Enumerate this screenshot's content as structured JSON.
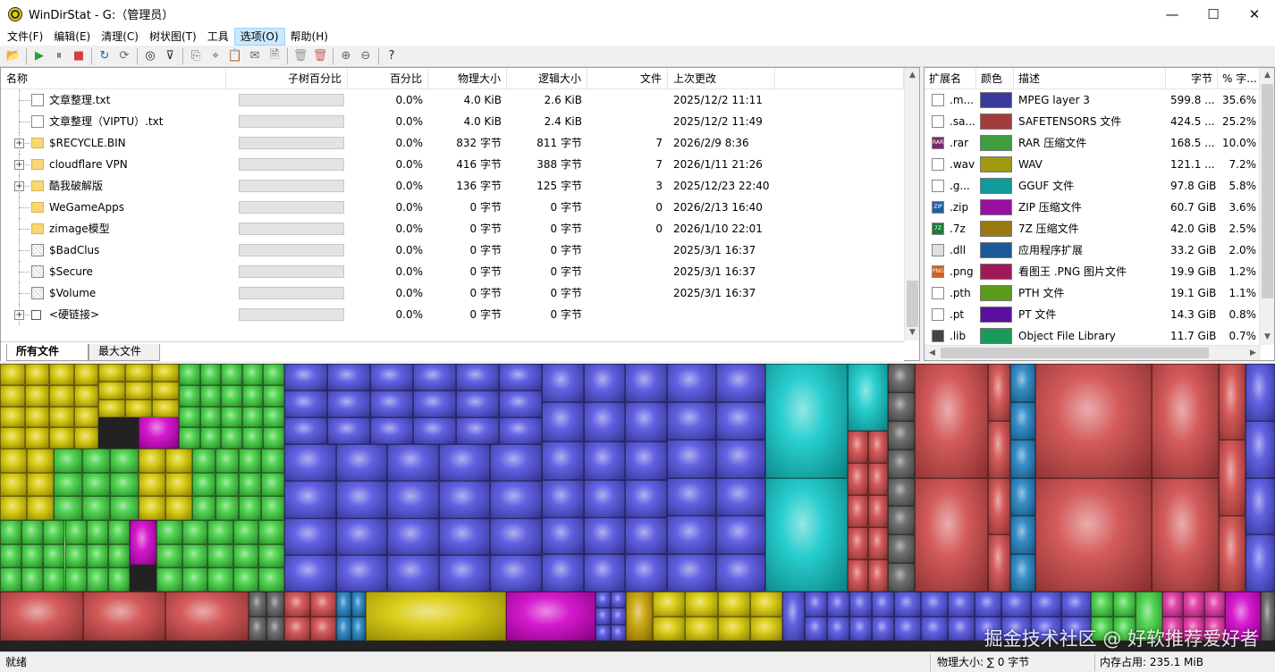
{
  "window": {
    "title": "WinDirStat - G:（管理员）",
    "minimize": "—",
    "maximize": "☐",
    "close": "✕"
  },
  "menu": [
    "文件(F)",
    "编辑(E)",
    "清理(C)",
    "树状图(T)",
    "工具",
    "选项(O)",
    "帮助(H)"
  ],
  "menu_active_index": 5,
  "toolbar": [
    {
      "name": "open-icon",
      "glyph": "📂"
    },
    {
      "sep": true
    },
    {
      "name": "play-icon",
      "glyph": "▶"
    },
    {
      "name": "pause-icon",
      "glyph": "⏸"
    },
    {
      "name": "stop-icon",
      "glyph": "■"
    },
    {
      "sep": true
    },
    {
      "name": "refresh-icon",
      "glyph": "↻"
    },
    {
      "name": "refresh-selected-icon",
      "glyph": "⟳"
    },
    {
      "sep": true
    },
    {
      "name": "zoom-scan-icon",
      "glyph": "◎"
    },
    {
      "name": "filter-icon",
      "glyph": "⊽"
    },
    {
      "sep": true
    },
    {
      "name": "copy-path-icon",
      "glyph": "⎘"
    },
    {
      "name": "explorer-icon",
      "glyph": "⌖"
    },
    {
      "name": "paste-icon",
      "glyph": "📋"
    },
    {
      "name": "properties-icon",
      "glyph": "✉"
    },
    {
      "name": "report-icon",
      "glyph": "🗎"
    },
    {
      "sep": true
    },
    {
      "name": "recycle-icon",
      "glyph": "🗑"
    },
    {
      "name": "delete-icon",
      "glyph": "🗑"
    },
    {
      "sep": true
    },
    {
      "name": "zoom-in-icon",
      "glyph": "⊕"
    },
    {
      "name": "zoom-out-icon",
      "glyph": "⊖"
    },
    {
      "sep": true
    },
    {
      "name": "help-icon",
      "glyph": "?"
    }
  ],
  "tree": {
    "columns": [
      "名称",
      "子树百分比",
      "百分比",
      "物理大小",
      "逻辑大小",
      "文件",
      "上次更改"
    ],
    "rows": [
      {
        "name": "文章整理.txt",
        "type": "file",
        "expandable": false,
        "percent": "0.0%",
        "physical": "4.0 KiB",
        "logical": "2.6 KiB",
        "files": "",
        "modified": "2025/12/2  11:11"
      },
      {
        "name": "文章整理（VIPTU）.txt",
        "type": "file",
        "expandable": false,
        "percent": "0.0%",
        "physical": "4.0 KiB",
        "logical": "2.4 KiB",
        "files": "",
        "modified": "2025/12/2  11:49"
      },
      {
        "name": "$RECYCLE.BIN",
        "type": "folder",
        "expandable": true,
        "percent": "0.0%",
        "physical": "832 字节",
        "logical": "811 字节",
        "files": "7",
        "modified": "2026/2/9  8:36"
      },
      {
        "name": "cloudflare VPN",
        "type": "folder",
        "expandable": true,
        "percent": "0.0%",
        "physical": "416 字节",
        "logical": "388 字节",
        "files": "7",
        "modified": "2026/1/11  21:26"
      },
      {
        "name": "酷我破解版",
        "type": "folder",
        "expandable": true,
        "percent": "0.0%",
        "physical": "136 字节",
        "logical": "125 字节",
        "files": "3",
        "modified": "2025/12/23  22:40"
      },
      {
        "name": "WeGameApps",
        "type": "folder",
        "expandable": false,
        "percent": "0.0%",
        "physical": "0 字节",
        "logical": "0 字节",
        "files": "0",
        "modified": "2026/2/13  16:40"
      },
      {
        "name": "zimage模型",
        "type": "folder",
        "expandable": false,
        "percent": "0.0%",
        "physical": "0 字节",
        "logical": "0 字节",
        "files": "0",
        "modified": "2026/1/10  22:01"
      },
      {
        "name": "$BadClus",
        "type": "sys",
        "expandable": false,
        "percent": "0.0%",
        "physical": "0 字节",
        "logical": "0 字节",
        "files": "",
        "modified": "2025/3/1  16:37"
      },
      {
        "name": "$Secure",
        "type": "sys",
        "expandable": false,
        "percent": "0.0%",
        "physical": "0 字节",
        "logical": "0 字节",
        "files": "",
        "modified": "2025/3/1  16:37"
      },
      {
        "name": "$Volume",
        "type": "sys",
        "expandable": false,
        "percent": "0.0%",
        "physical": "0 字节",
        "logical": "0 字节",
        "files": "",
        "modified": "2025/3/1  16:37"
      },
      {
        "name": "<硬链接>",
        "type": "link",
        "expandable": true,
        "percent": "0.0%",
        "physical": "0 字节",
        "logical": "0 字节",
        "files": "",
        "modified": ""
      }
    ]
  },
  "tabs": [
    "所有文件",
    "最大文件"
  ],
  "extensions": {
    "columns": [
      "扩展名",
      "颜色",
      "描述",
      "字节",
      "% 字..."
    ],
    "rows": [
      {
        "ext": ".m...",
        "color": "#3a3a9c",
        "desc": "MPEG layer 3",
        "bytes": "599.8 ...",
        "pct": "35.6%",
        "icon": "file-icon",
        "iconbg": "#fff",
        "icontext": ""
      },
      {
        "ext": ".sa...",
        "color": "#a03c3c",
        "desc": "SAFETENSORS 文件",
        "bytes": "424.5 ...",
        "pct": "25.2%",
        "icon": "file-icon",
        "iconbg": "#fff",
        "icontext": ""
      },
      {
        "ext": ".rar",
        "color": "#3e9e3e",
        "desc": "RAR 压缩文件",
        "bytes": "168.5 ...",
        "pct": "10.0%",
        "icon": "rar-archive-icon",
        "iconbg": "#7a2a6a",
        "icontext": "RAR"
      },
      {
        "ext": ".wav",
        "color": "#a09a10",
        "desc": "WAV",
        "bytes": "121.1 ...",
        "pct": "7.2%",
        "icon": "file-icon",
        "iconbg": "#fff",
        "icontext": ""
      },
      {
        "ext": ".g...",
        "color": "#109a9a",
        "desc": "GGUF 文件",
        "bytes": "97.8 GiB",
        "pct": "5.8%",
        "icon": "file-icon",
        "iconbg": "#fff",
        "icontext": ""
      },
      {
        "ext": ".zip",
        "color": "#9a10a0",
        "desc": "ZIP 压缩文件",
        "bytes": "60.7 GiB",
        "pct": "3.6%",
        "icon": "zip-archive-icon",
        "iconbg": "#1f5fa0",
        "icontext": "ZIP"
      },
      {
        "ext": ".7z",
        "color": "#9a7a10",
        "desc": "7Z 压缩文件",
        "bytes": "42.0 GiB",
        "pct": "2.5%",
        "icon": "7z-archive-icon",
        "iconbg": "#1f7a3a",
        "icontext": "7Z"
      },
      {
        "ext": ".dll",
        "color": "#1a5a9a",
        "desc": "应用程序扩展",
        "bytes": "33.2 GiB",
        "pct": "2.0%",
        "icon": "dll-icon",
        "iconbg": "#e0e0e0",
        "icontext": ""
      },
      {
        "ext": ".png",
        "color": "#a01a5a",
        "desc": "看图王 .PNG 图片文件",
        "bytes": "19.9 GiB",
        "pct": "1.2%",
        "icon": "png-image-icon",
        "iconbg": "#d06020",
        "icontext": "PNG"
      },
      {
        "ext": ".pth",
        "color": "#5a9a1a",
        "desc": "PTH 文件",
        "bytes": "19.1 GiB",
        "pct": "1.1%",
        "icon": "file-icon",
        "iconbg": "#fff",
        "icontext": ""
      },
      {
        "ext": ".pt",
        "color": "#5a10a0",
        "desc": "PT 文件",
        "bytes": "14.3 GiB",
        "pct": "0.8%",
        "icon": "file-icon",
        "iconbg": "#fff",
        "icontext": ""
      },
      {
        "ext": ".lib",
        "color": "#1a9a5a",
        "desc": "Object File Library",
        "bytes": "11.7 GiB",
        "pct": "0.7%",
        "icon": "library-icon",
        "iconbg": "#444",
        "icontext": ""
      }
    ]
  },
  "treemap_watermark": "掘金技术社区 @ 好软推荐爱好者",
  "status": {
    "left": "就绪",
    "physical": "物理大小: ∑ 0 字节",
    "memory": "内存占用:  235.1 MiB"
  }
}
